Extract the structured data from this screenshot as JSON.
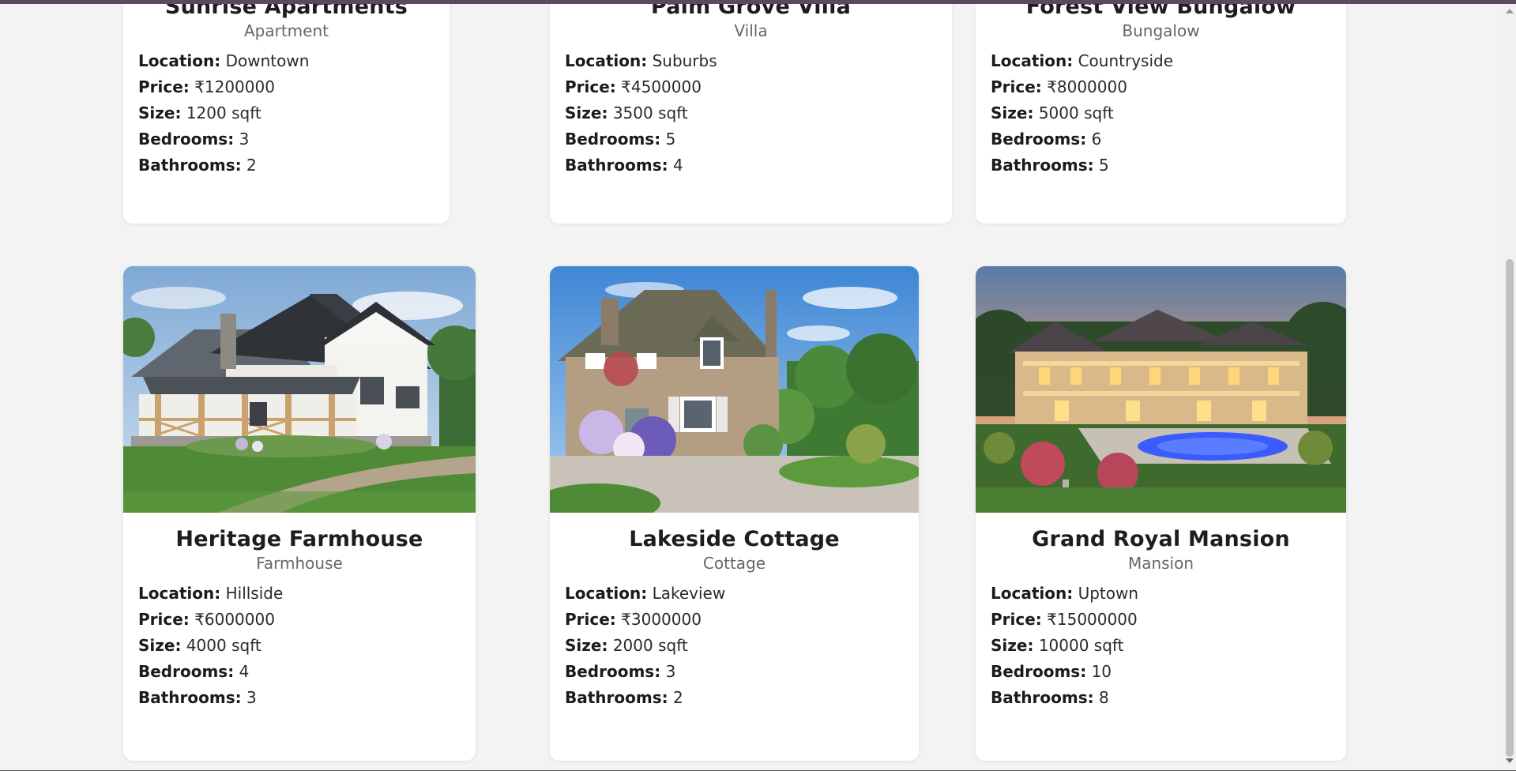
{
  "properties": [
    {
      "name": "Sunrise Apartments",
      "type": "Apartment",
      "location_label": "Location:",
      "location": "Downtown",
      "price_label": "Price:",
      "price": "₹1200000",
      "size_label": "Size:",
      "size": "1200 sqft",
      "bedrooms_label": "Bedrooms:",
      "bedrooms": "3",
      "bathrooms_label": "Bathrooms:",
      "bathrooms": "2"
    },
    {
      "name": "Palm Grove Villa",
      "type": "Villa",
      "location_label": "Location:",
      "location": "Suburbs",
      "price_label": "Price:",
      "price": "₹4500000",
      "size_label": "Size:",
      "size": "3500 sqft",
      "bedrooms_label": "Bedrooms:",
      "bedrooms": "5",
      "bathrooms_label": "Bathrooms:",
      "bathrooms": "4"
    },
    {
      "name": "Forest View Bungalow",
      "type": "Bungalow",
      "location_label": "Location:",
      "location": "Countryside",
      "price_label": "Price:",
      "price": "₹8000000",
      "size_label": "Size:",
      "size": "5000 sqft",
      "bedrooms_label": "Bedrooms:",
      "bedrooms": "6",
      "bathrooms_label": "Bathrooms:",
      "bathrooms": "5"
    },
    {
      "name": "Heritage Farmhouse",
      "type": "Farmhouse",
      "location_label": "Location:",
      "location": "Hillside",
      "price_label": "Price:",
      "price": "₹6000000",
      "size_label": "Size:",
      "size": "4000 sqft",
      "bedrooms_label": "Bedrooms:",
      "bedrooms": "4",
      "bathrooms_label": "Bathrooms:",
      "bathrooms": "3",
      "image": "farmhouse-photo"
    },
    {
      "name": "Lakeside Cottage",
      "type": "Cottage",
      "location_label": "Location:",
      "location": "Lakeview",
      "price_label": "Price:",
      "price": "₹3000000",
      "size_label": "Size:",
      "size": "2000 sqft",
      "bedrooms_label": "Bedrooms:",
      "bedrooms": "3",
      "bathrooms_label": "Bathrooms:",
      "bathrooms": "2",
      "image": "cottage-photo"
    },
    {
      "name": "Grand Royal Mansion",
      "type": "Mansion",
      "location_label": "Location:",
      "location": "Uptown",
      "price_label": "Price:",
      "price": "₹15000000",
      "size_label": "Size:",
      "size": "10000 sqft",
      "bedrooms_label": "Bedrooms:",
      "bedrooms": "10",
      "bathrooms_label": "Bathrooms:",
      "bathrooms": "8",
      "image": "mansion-photo"
    }
  ],
  "colors": {
    "page_background": "#f3f3f3",
    "card_background": "#ffffff",
    "title_text": "#1d1d1d",
    "subtitle_text": "#666666"
  }
}
